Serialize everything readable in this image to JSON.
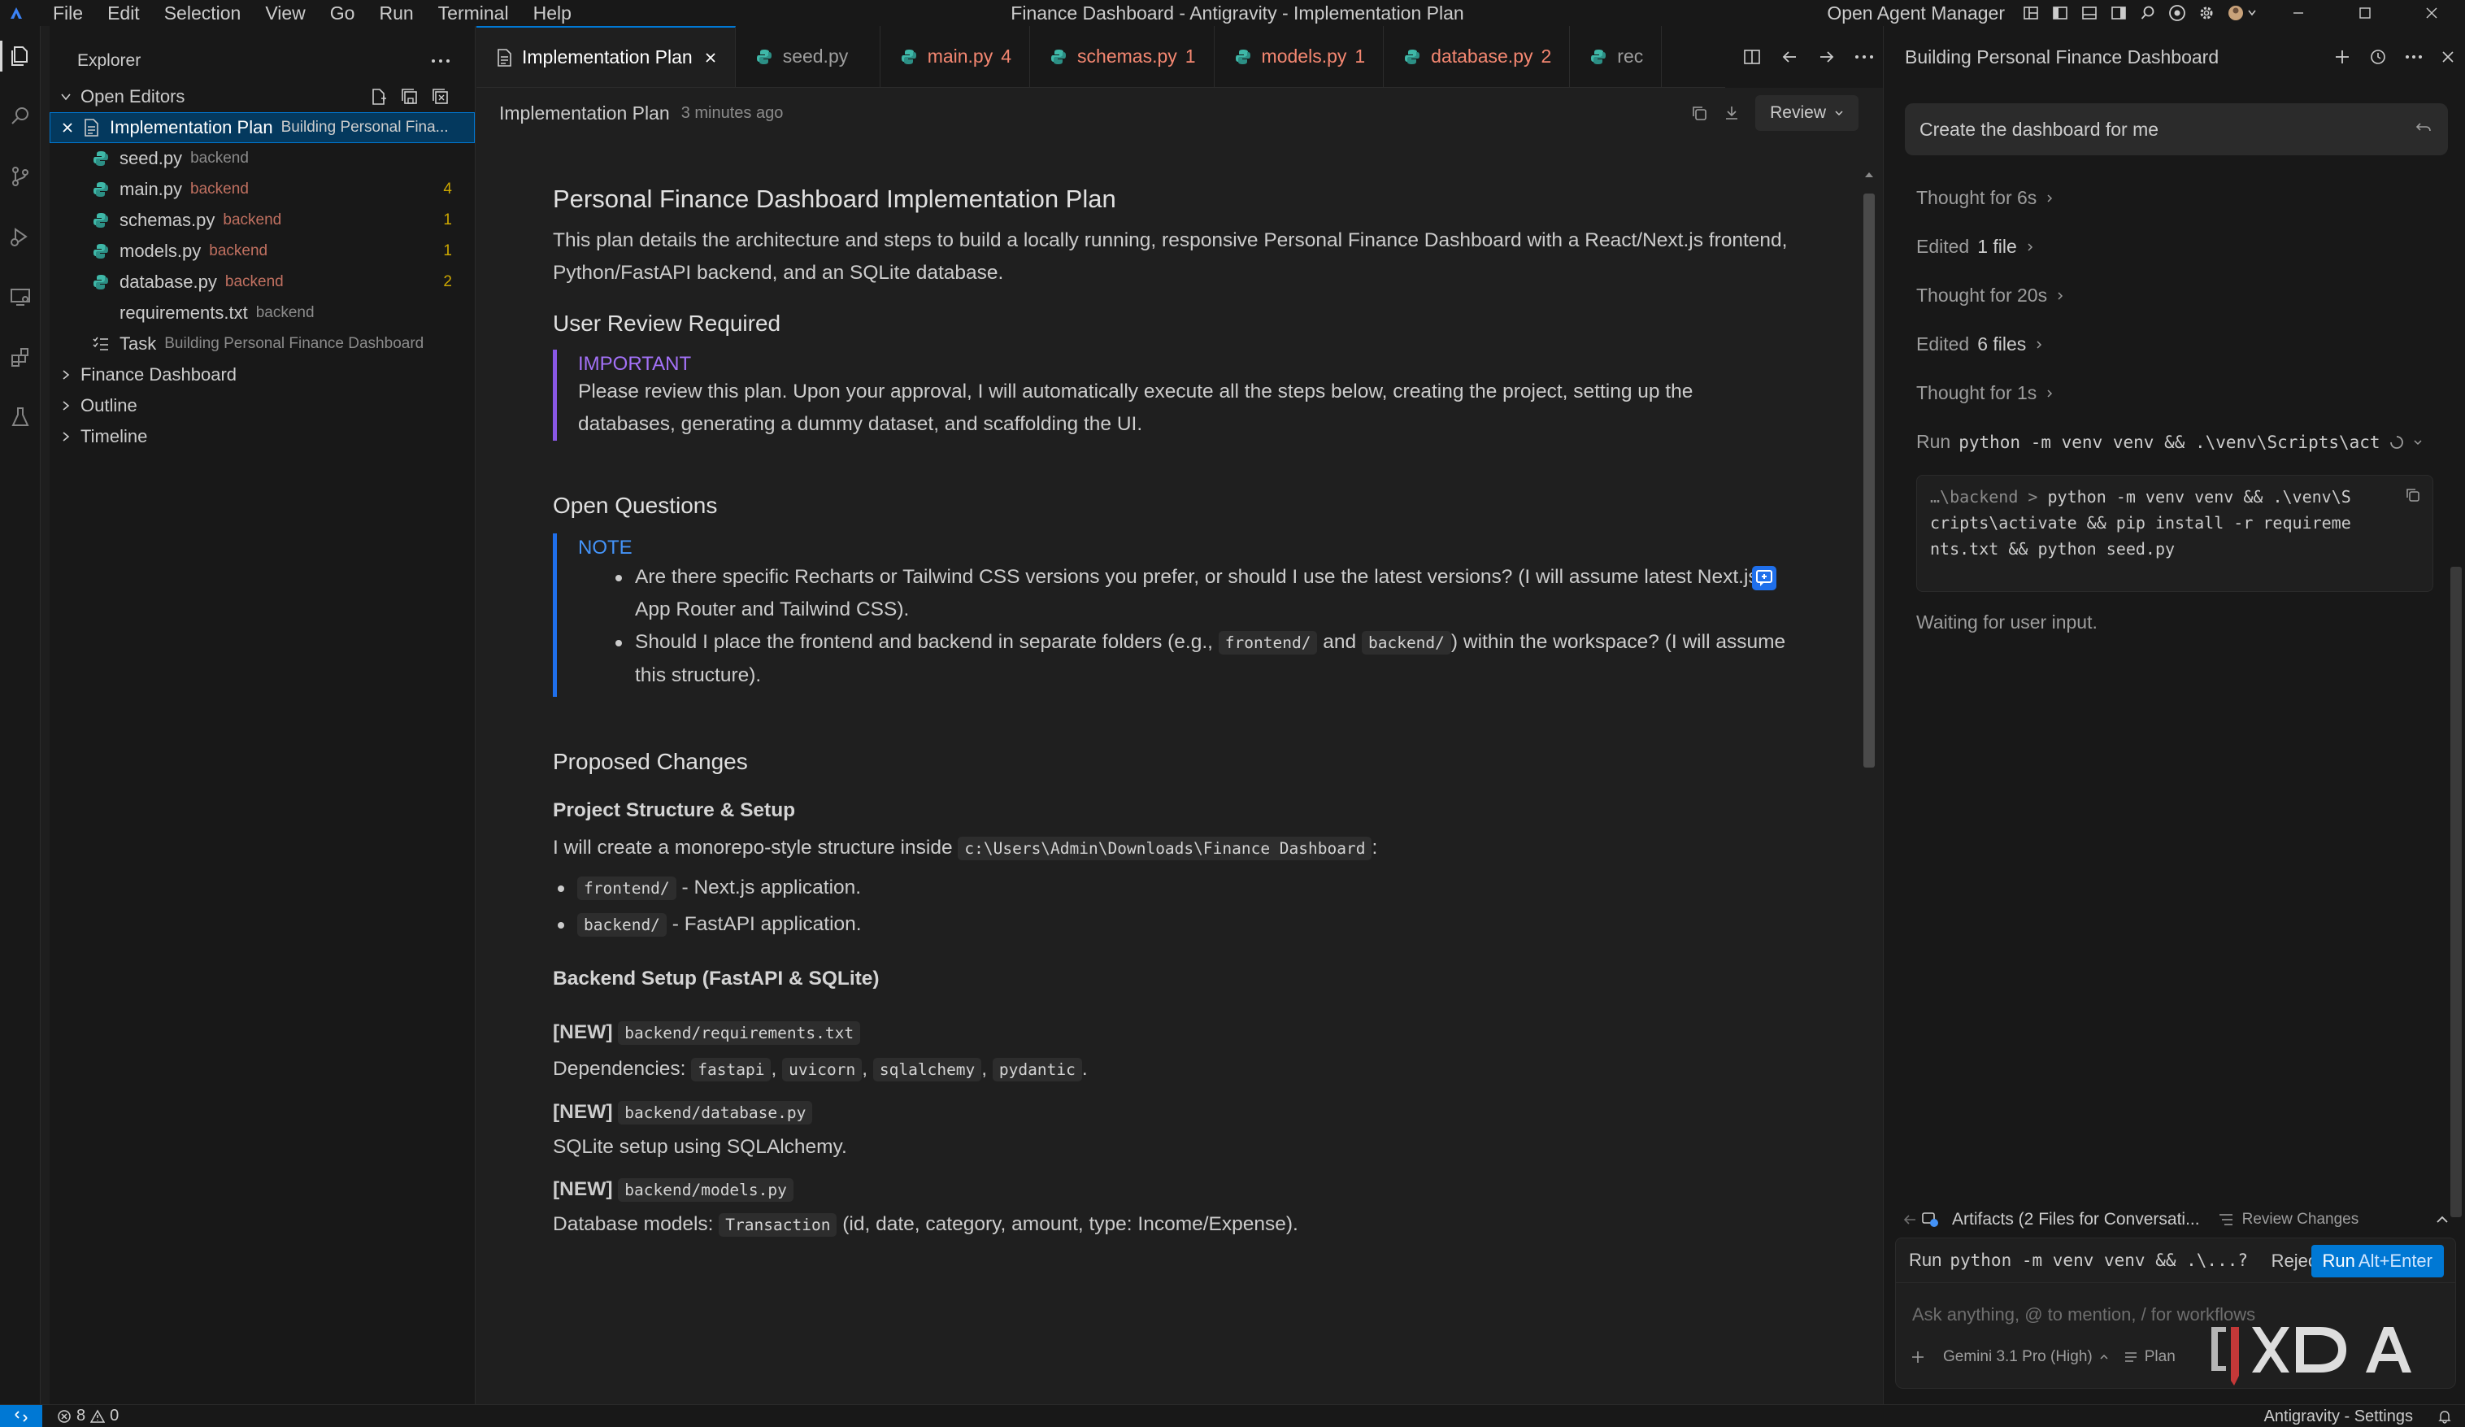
{
  "titlebar": {
    "menu": [
      "File",
      "Edit",
      "Selection",
      "View",
      "Go",
      "Run",
      "Terminal",
      "Help"
    ],
    "window_title": "Finance Dashboard - Antigravity - Implementation Plan",
    "agent_manager": "Open Agent Manager"
  },
  "sidebar": {
    "title": "Explorer",
    "open_editors_label": "Open Editors",
    "open_editors": [
      {
        "name": "Implementation Plan",
        "desc": "Building Personal Fina...",
        "icon": "document-icon"
      },
      {
        "name": "seed.py",
        "desc": "backend",
        "icon": "python-icon"
      },
      {
        "name": "main.py",
        "desc": "backend",
        "icon": "python-icon",
        "badge": "4"
      },
      {
        "name": "schemas.py",
        "desc": "backend",
        "icon": "python-icon",
        "badge": "1"
      },
      {
        "name": "models.py",
        "desc": "backend",
        "icon": "python-icon",
        "badge": "1"
      },
      {
        "name": "database.py",
        "desc": "backend",
        "icon": "python-icon",
        "badge": "2"
      },
      {
        "name": "requirements.txt",
        "desc": "backend",
        "icon": "text-file-icon"
      },
      {
        "name": "Task",
        "desc": "Building Personal Finance Dashboard",
        "icon": "checklist-icon"
      }
    ],
    "sections": [
      "Finance Dashboard",
      "Outline",
      "Timeline"
    ]
  },
  "tabs": [
    {
      "label": "Implementation Plan"
    },
    {
      "label": "seed.py"
    },
    {
      "label": "main.py",
      "count": "4"
    },
    {
      "label": "schemas.py",
      "count": "1"
    },
    {
      "label": "models.py",
      "count": "1"
    },
    {
      "label": "database.py",
      "count": "2"
    },
    {
      "label": "rec"
    }
  ],
  "docbar": {
    "title": "Implementation Plan",
    "time": "3 minutes ago",
    "review": "Review"
  },
  "doc": {
    "title": "Personal Finance Dashboard Implementation Plan",
    "intro": "This plan details the architecture and steps to build a locally running, responsive Personal Finance Dashboard with a React/Next.js frontend, Python/FastAPI backend, and an SQLite database.",
    "review_heading": "User Review Required",
    "important_label": "IMPORTANT",
    "important_text": "Please review this plan. Upon your approval, I will automatically execute all the steps below, creating the project, setting up the databases, generating a dummy dataset, and scaffolding the UI.",
    "questions_heading": "Open Questions",
    "note_label": "NOTE",
    "q1": "Are there specific Recharts or Tailwind CSS versions you prefer, or should I use the latest versions? (I will assume latest Next.js App Router and Tailwind CSS).",
    "q2_a": "Should I place the frontend and backend in separate folders (e.g.,",
    "q2_code1": "frontend/",
    "q2_and": "and",
    "q2_code2": "backend/",
    "q2_b": ") within the workspace? (I will assume this structure).",
    "changes_heading": "Proposed Changes",
    "structure_heading": "Project Structure & Setup",
    "structure_text": "I will create a monorepo-style structure inside",
    "structure_path": "c:\\Users\\Admin\\Downloads\\Finance Dashboard",
    "structure_colon": ":",
    "b1_code": "frontend/",
    "b1_text": "- Next.js application.",
    "b2_code": "backend/",
    "b2_text": "- FastAPI application.",
    "backend_heading": "Backend Setup (FastAPI & SQLite)",
    "new_tag": "[NEW]",
    "req_file": "backend/requirements.txt",
    "deps_label": "Dependencies:",
    "deps": [
      "fastapi",
      "uvicorn",
      "sqlalchemy",
      "pydantic"
    ],
    "db_file": "backend/database.py",
    "db_text": "SQLite setup using SQLAlchemy.",
    "models_file": "backend/models.py",
    "models_label": "Database models:",
    "models_code": "Transaction",
    "models_text": "(id, date, category, amount, type: Income/Expense)."
  },
  "agent": {
    "title": "Building Personal Finance Dashboard",
    "prompt": "Create the dashboard for me",
    "steps": [
      {
        "pre": "Thought for 6s",
        "strong": ""
      },
      {
        "pre": "Edited",
        "strong": "1 file"
      },
      {
        "pre": "Thought for 20s",
        "strong": ""
      },
      {
        "pre": "Edited",
        "strong": "6 files"
      },
      {
        "pre": "Thought for 1s",
        "strong": ""
      }
    ],
    "run_label": "Run",
    "run_cmd": "python -m venv venv && .\\venv\\Scripts\\act",
    "cmd_path": "…\\backend",
    "cmd_sep": ">",
    "cmd_line1": "python -m venv venv && .\\venv\\S",
    "cmd_line2": "cripts\\activate && pip install -r requireme",
    "cmd_line3": "nts.txt && python seed.py",
    "waiting": "Waiting for user input.",
    "artifacts": "Artifacts (2 Files for Conversati...",
    "review_changes": "Review Changes",
    "runbar_label": "Run",
    "runbar_cmd": "python -m venv venv && .\\...?",
    "reject": "Reject",
    "run_btn": "Run",
    "run_kbd": "Alt+Enter",
    "input_placeholder": "Ask anything, @ to mention, / for workflows",
    "model": "Gemini 3.1 Pro (High)",
    "mode": "Plan"
  },
  "statusbar": {
    "errors": "8",
    "warnings": "0",
    "right": "Antigravity - Settings"
  },
  "colors": {
    "accent": "#0078d4",
    "important": "#a371f7",
    "note": "#4493f8",
    "error": "#f48771",
    "warning": "#cca700"
  }
}
